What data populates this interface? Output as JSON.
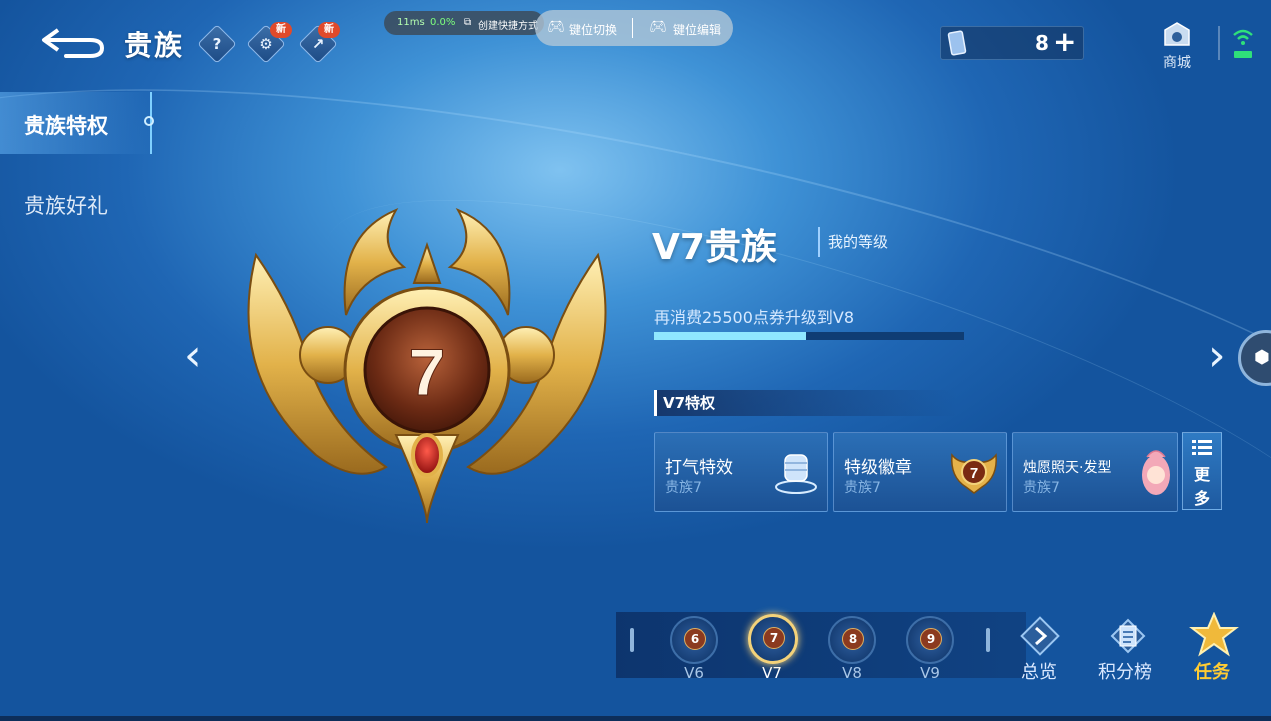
{
  "header": {
    "title": "贵族",
    "help_icon": "?",
    "new_badge_1": "新",
    "new_badge_2": "新",
    "perf_ms": "11ms",
    "perf_loss": "0.0%",
    "shortcut_label": "创建快捷方式",
    "key_switch_label": "键位切换",
    "key_edit_label": "键位编辑",
    "ticket_count": "8",
    "ticket_plus": "+",
    "shop_label": "商城"
  },
  "sidebar": {
    "items": [
      {
        "label": "贵族特权",
        "active": true
      },
      {
        "label": "贵族好礼",
        "active": false
      }
    ]
  },
  "badge": {
    "level": "7"
  },
  "rank": {
    "title": "V7贵族",
    "my_level_label": "我的等级",
    "progress_text": "再消费25500点券升级到V8",
    "progress_fraction": 0.49
  },
  "privileges": {
    "section_title": "V7特权",
    "cards": [
      {
        "title": "打气特效",
        "sub": "贵族7",
        "icon": "fist-icon"
      },
      {
        "title": "特级徽章",
        "sub": "贵族7",
        "icon": "badge-icon"
      },
      {
        "title": "烛愿照天·发型",
        "sub": "贵族7",
        "icon": "hairstyle-icon"
      }
    ],
    "more_line1": "更",
    "more_line2": "多"
  },
  "levels": [
    {
      "num": "6",
      "label": "V6",
      "selected": false
    },
    {
      "num": "7",
      "label": "V7",
      "selected": true
    },
    {
      "num": "8",
      "label": "V8",
      "selected": false
    },
    {
      "num": "9",
      "label": "V9",
      "selected": false
    }
  ],
  "bottom_nav": {
    "overview": "总览",
    "leaderboard": "积分榜",
    "tasks": "任务"
  },
  "colors": {
    "accent_gold": "#f0c04a",
    "progress_fill": "#8fe7ff",
    "task_gold": "#ffcc33"
  }
}
